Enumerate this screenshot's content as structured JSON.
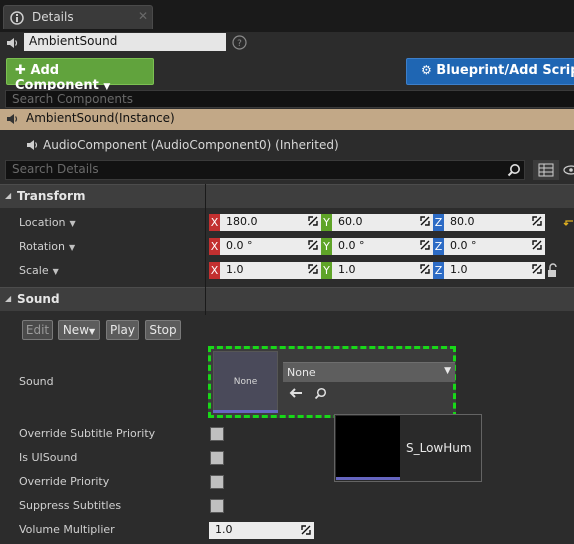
{
  "tab": {
    "title": "Details"
  },
  "actor_name": "AmbientSound",
  "toolbar": {
    "add_component": "Add Component",
    "blueprint": "Blueprint/Add Script"
  },
  "components": {
    "search_placeholder": "Search Components",
    "items": [
      {
        "label": "AmbientSound(Instance)",
        "selected": true
      },
      {
        "label": "AudioComponent (AudioComponent0) (Inherited)",
        "selected": false
      }
    ]
  },
  "details_search_placeholder": "Search Details",
  "transform": {
    "title": "Transform",
    "location": {
      "label": "Location",
      "x": "180.0",
      "y": "60.0",
      "z": "80.0"
    },
    "rotation": {
      "label": "Rotation",
      "x": "0.0 °",
      "y": "0.0 °",
      "z": "0.0 °"
    },
    "scale": {
      "label": "Scale",
      "x": "1.0",
      "y": "1.0",
      "z": "1.0"
    },
    "axis_labels": {
      "x": "X",
      "y": "Y",
      "z": "Z"
    }
  },
  "sound": {
    "title": "Sound",
    "buttons": {
      "edit": "Edit",
      "new": "New",
      "play": "Play",
      "stop": "Stop"
    },
    "sound_label": "Sound",
    "thumb_label": "None",
    "combo_value": "None",
    "tooltip_asset": "S_LowHum",
    "properties": [
      {
        "label": "Override Subtitle Priority",
        "checked": false
      },
      {
        "label": "Is UISound",
        "checked": false
      },
      {
        "label": "Override Priority",
        "checked": false
      },
      {
        "label": "Suppress Subtitles",
        "checked": false
      }
    ],
    "volume": {
      "label": "Volume Multiplier",
      "value": "1.0"
    }
  },
  "colors": {
    "selected_row": "#c2a887",
    "add_button": "#61a33d",
    "blueprint_button": "#1f66b3",
    "drop_highlight": "#18d818",
    "axis_x": "#c33030",
    "axis_y": "#5fa428",
    "axis_z": "#2c6bc5"
  },
  "icons": {
    "tab": "details-icon",
    "name": "speaker-icon",
    "help": "help-icon",
    "search": "search-icon",
    "grid": "property-matrix-icon",
    "eye": "eye-icon",
    "lock": "lock-icon",
    "reset": "reset-arrow-icon",
    "use": "use-selected-arrow-icon",
    "browse": "browse-magnifier-icon"
  }
}
